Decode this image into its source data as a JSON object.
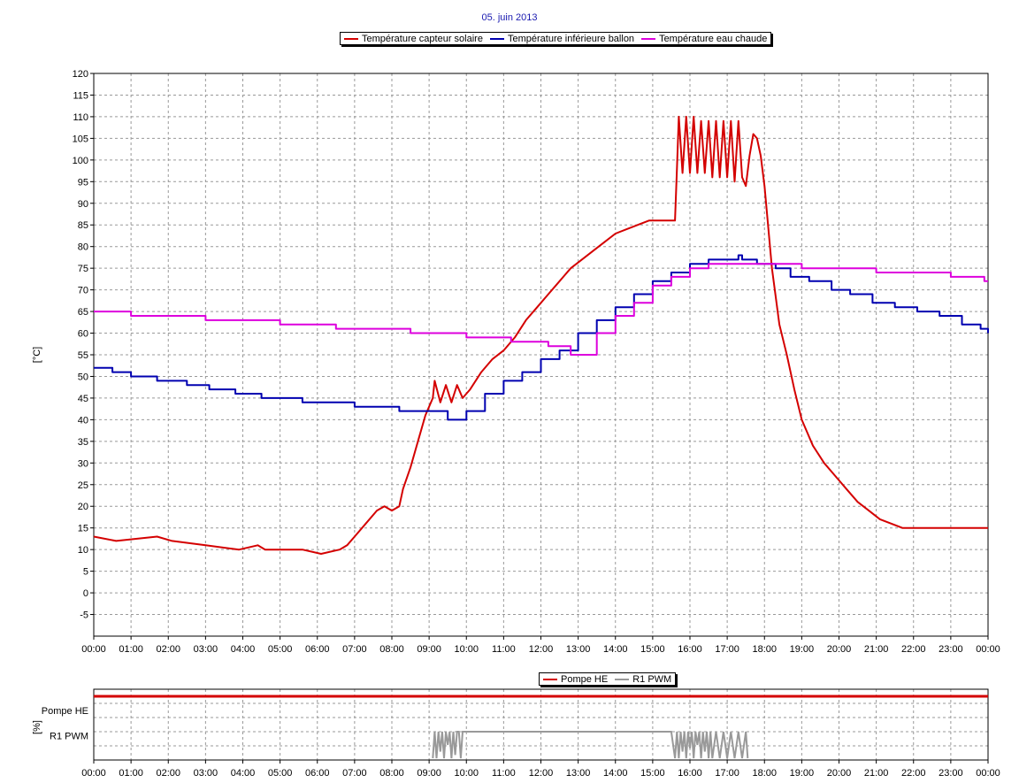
{
  "chart_data": [
    {
      "type": "line",
      "title": "05. juin 2013",
      "ylabel": "[°C]",
      "xlabel": "",
      "x_ticks": [
        "00:00",
        "01:00",
        "02:00",
        "03:00",
        "04:00",
        "05:00",
        "06:00",
        "07:00",
        "08:00",
        "09:00",
        "10:00",
        "11:00",
        "12:00",
        "13:00",
        "14:00",
        "15:00",
        "16:00",
        "17:00",
        "18:00",
        "19:00",
        "20:00",
        "21:00",
        "22:00",
        "23:00",
        "00:00"
      ],
      "xlim": [
        0,
        24
      ],
      "ylim": [
        -10,
        120
      ],
      "y_ticks": [
        -5,
        0,
        5,
        10,
        15,
        20,
        25,
        30,
        35,
        40,
        45,
        50,
        55,
        60,
        65,
        70,
        75,
        80,
        85,
        90,
        95,
        100,
        105,
        110,
        115,
        120
      ],
      "grid": true,
      "legend_position": "top-center",
      "series": [
        {
          "name": "Température capteur solaire",
          "color": "#d40000",
          "x": [
            0,
            0.6,
            1.7,
            2.1,
            3.0,
            3.9,
            4.4,
            4.6,
            5.6,
            6.1,
            6.6,
            6.8,
            7.0,
            7.3,
            7.6,
            7.8,
            8.0,
            8.2,
            8.3,
            8.5,
            8.7,
            8.9,
            9.1,
            9.15,
            9.3,
            9.45,
            9.6,
            9.75,
            9.9,
            10.1,
            10.4,
            10.7,
            11.0,
            11.3,
            11.6,
            11.9,
            12.2,
            12.5,
            12.8,
            13.1,
            13.4,
            13.7,
            14.0,
            14.3,
            14.6,
            14.9,
            15.2,
            15.6,
            15.65,
            15.7,
            15.8,
            15.9,
            16.0,
            16.1,
            16.2,
            16.3,
            16.4,
            16.5,
            16.6,
            16.7,
            16.8,
            16.9,
            17.0,
            17.1,
            17.2,
            17.3,
            17.4,
            17.5,
            17.6,
            17.7,
            17.8,
            17.9,
            18.0,
            18.2,
            18.4,
            18.6,
            18.8,
            19.0,
            19.3,
            19.6,
            19.9,
            20.2,
            20.5,
            20.8,
            21.1,
            21.4,
            21.7,
            22.0,
            22.3,
            22.6,
            22.9,
            23.2,
            23.5,
            23.8,
            24.0
          ],
          "y": [
            13,
            12,
            13,
            12,
            11,
            10,
            11,
            10,
            10,
            9,
            10,
            11,
            13,
            16,
            19,
            20,
            19,
            20,
            24,
            29,
            35,
            41,
            45,
            49,
            44,
            48,
            44,
            48,
            45,
            47,
            51,
            54,
            56,
            59,
            63,
            66,
            69,
            72,
            75,
            77,
            79,
            81,
            83,
            84,
            85,
            86,
            86,
            86,
            98,
            110,
            97,
            110,
            97,
            110,
            97,
            109,
            97,
            109,
            96,
            109,
            96,
            109,
            96,
            109,
            95,
            109,
            96,
            94,
            101,
            106,
            105,
            101,
            94,
            75,
            62,
            55,
            47,
            40,
            34,
            30,
            27,
            24,
            21,
            19,
            17,
            16,
            15,
            15,
            15,
            15,
            15,
            15,
            15,
            15,
            15
          ],
          "y_note": "last 0.8h held at 15"
        },
        {
          "name": "Température inférieure ballon",
          "color": "#0000b0",
          "x": [
            0,
            0.5,
            1.0,
            1.7,
            2.5,
            3.1,
            3.8,
            4.5,
            5.6,
            7.0,
            8.2,
            9.0,
            9.5,
            10.0,
            10.5,
            11.0,
            11.5,
            12.0,
            12.5,
            13.0,
            13.5,
            14.0,
            14.5,
            15.0,
            15.5,
            16.0,
            16.5,
            17.0,
            17.3,
            17.4,
            17.8,
            18.3,
            18.7,
            19.2,
            19.8,
            20.3,
            20.9,
            21.5,
            22.1,
            22.7,
            23.3,
            23.8,
            24.0
          ],
          "y": [
            52,
            51,
            50,
            49,
            48,
            47,
            46,
            45,
            44,
            43,
            42,
            42,
            40,
            42,
            46,
            49,
            51,
            54,
            56,
            60,
            63,
            66,
            69,
            72,
            74,
            76,
            77,
            77,
            78,
            77,
            76,
            75,
            73,
            72,
            70,
            69,
            67,
            66,
            65,
            64,
            62,
            61,
            60
          ]
        },
        {
          "name": "Température eau chaude",
          "color": "#dd00dd",
          "x": [
            0,
            1.0,
            3.0,
            5.0,
            6.5,
            8.5,
            10.0,
            11.2,
            12.2,
            12.8,
            13.5,
            14.0,
            14.5,
            15.0,
            15.5,
            16.0,
            16.5,
            17.0,
            17.5,
            19.0,
            21.0,
            23.0,
            23.9,
            24.0
          ],
          "y": [
            65,
            64,
            63,
            62,
            61,
            60,
            59,
            58,
            57,
            55,
            60,
            64,
            67,
            71,
            73,
            75,
            76,
            76,
            76,
            75,
            74,
            73,
            72,
            72
          ]
        }
      ]
    },
    {
      "type": "line",
      "title": "",
      "ylabel": "[%]",
      "y_category_labels": [
        "Pompe HE",
        "R1 PWM"
      ],
      "x_ticks": [
        "00:00",
        "01:00",
        "02:00",
        "03:00",
        "04:00",
        "05:00",
        "06:00",
        "07:00",
        "08:00",
        "09:00",
        "10:00",
        "11:00",
        "12:00",
        "13:00",
        "14:00",
        "15:00",
        "16:00",
        "17:00",
        "18:00",
        "19:00",
        "20:00",
        "21:00",
        "22:00",
        "23:00",
        "00:00"
      ],
      "xlim": [
        0,
        24
      ],
      "ylim": [
        0,
        100
      ],
      "grid": true,
      "legend_position": "top-center",
      "series": [
        {
          "name": "Pompe HE",
          "color": "#d40000",
          "x": [
            0,
            24
          ],
          "y": [
            100,
            100
          ]
        },
        {
          "name": "R1 PWM",
          "color": "#999999",
          "x": [
            9.1,
            9.15,
            9.2,
            9.25,
            9.3,
            9.35,
            9.4,
            9.45,
            9.5,
            9.55,
            9.6,
            9.65,
            9.7,
            9.75,
            9.8,
            9.85,
            9.9,
            9.95,
            10.0,
            15.5,
            15.6,
            15.65,
            15.7,
            15.75,
            15.8,
            15.85,
            15.9,
            15.95,
            16.0,
            16.05,
            16.1,
            16.15,
            16.2,
            16.25,
            16.3,
            16.35,
            16.4,
            16.45,
            16.5,
            16.55,
            16.6,
            16.7,
            16.8,
            16.9,
            17.0,
            17.1,
            17.2,
            17.3,
            17.4,
            17.5,
            17.55
          ],
          "y": [
            0,
            40,
            0,
            40,
            10,
            40,
            0,
            40,
            20,
            40,
            0,
            40,
            5,
            40,
            40,
            0,
            40,
            40,
            40,
            40,
            0,
            40,
            0,
            40,
            10,
            40,
            0,
            40,
            15,
            40,
            0,
            40,
            20,
            40,
            0,
            40,
            10,
            40,
            0,
            40,
            0,
            40,
            0,
            40,
            0,
            40,
            0,
            40,
            0,
            40,
            0
          ]
        }
      ]
    }
  ]
}
